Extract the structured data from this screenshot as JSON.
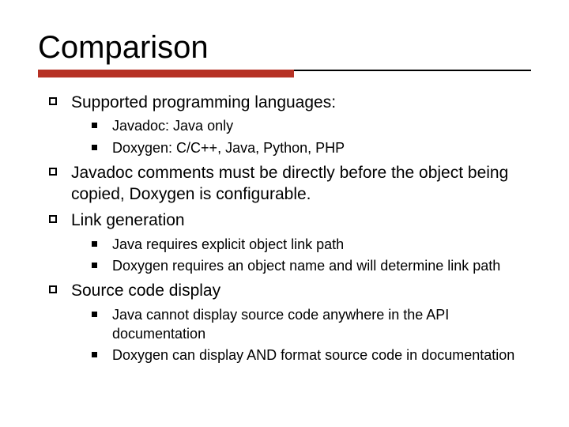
{
  "title": "Comparison",
  "bullets": [
    {
      "text": "Supported programming languages:",
      "sub": [
        "Javadoc: Java only",
        "Doxygen: C/C++, Java, Python, PHP"
      ]
    },
    {
      "text": "Javadoc comments must be directly before the object being copied, Doxygen is configurable.",
      "sub": []
    },
    {
      "text": "Link generation",
      "sub": [
        "Java requires explicit object link path",
        "Doxygen requires an object name and will determine link path"
      ]
    },
    {
      "text": "Source code display",
      "sub": [
        "Java cannot display source code anywhere in the API documentation",
        "Doxygen can display AND format source code in documentation"
      ]
    }
  ]
}
